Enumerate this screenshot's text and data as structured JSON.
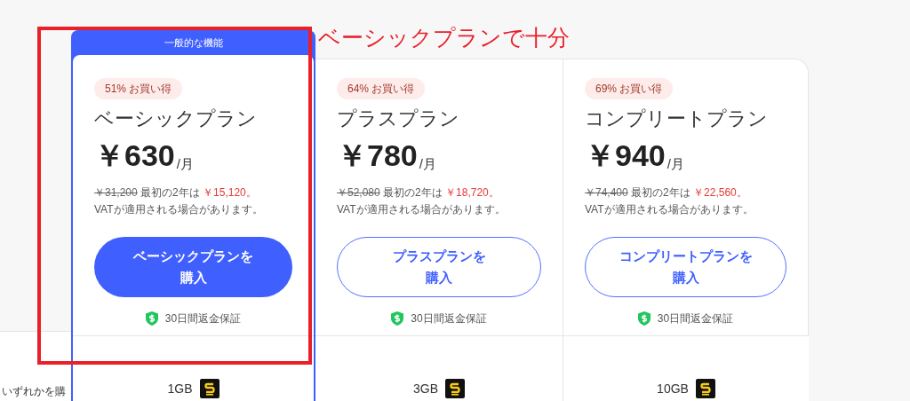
{
  "annotation": {
    "label": "ベーシックプランで十分"
  },
  "featured_label": "一般的な機能",
  "side_text": "いずれかを購",
  "plans": [
    {
      "selected": true,
      "badge": "51% お買い得",
      "name": "ベーシックプラン",
      "price": "￥630",
      "period": "/月",
      "original_price": "￥31,200",
      "offer_text": "最初の2年は",
      "offer_price": "￥15,120。",
      "vat_note": "VATが適用される場合があります。",
      "button": [
        "ベーシックプランを",
        "購入"
      ],
      "guarantee": "30日間返金保証",
      "storage": "1GB"
    },
    {
      "selected": false,
      "badge": "64% お買い得",
      "name": "プラスプラン",
      "price": "￥780",
      "period": "/月",
      "original_price": "￥52,080",
      "offer_text": "最初の2年は",
      "offer_price": "￥18,720。",
      "vat_note": "VATが適用される場合があります。",
      "button": [
        "プラスプランを",
        "購入"
      ],
      "guarantee": "30日間返金保証",
      "storage": "3GB"
    },
    {
      "selected": false,
      "badge": "69% お買い得",
      "name": "コンプリートプラン",
      "price": "￥940",
      "period": "/月",
      "original_price": "￥74,400",
      "offer_text": "最初の2年は",
      "offer_price": "￥22,560。",
      "vat_note": "VATが適用される場合があります。",
      "button": [
        "コンプリートプランを",
        "購入"
      ],
      "guarantee": "30日間返金保証",
      "storage": "10GB"
    }
  ]
}
